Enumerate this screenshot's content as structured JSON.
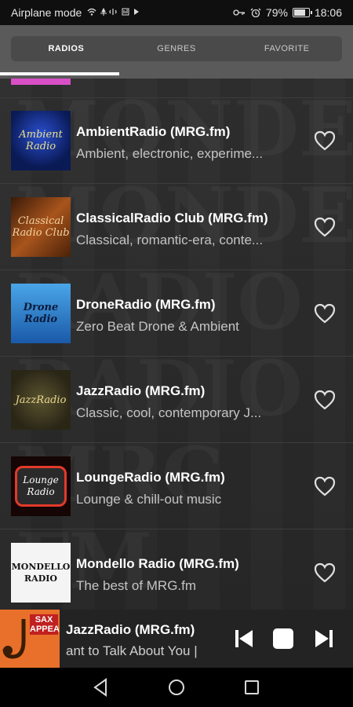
{
  "status_bar": {
    "carrier": "Airplane mode",
    "battery": "79%",
    "time": "18:06"
  },
  "tabs": [
    {
      "label": "RADIOS",
      "active": true
    },
    {
      "label": "GENRES",
      "active": false
    },
    {
      "label": "FAVORITE",
      "active": false
    }
  ],
  "stations": [
    {
      "title": "AmbientRadio (MRG.fm)",
      "subtitle": "Ambient, electronic, experime...",
      "logo_text": "Ambient Radio"
    },
    {
      "title": "ClassicalRadio Club (MRG.fm)",
      "subtitle": "Classical, romantic-era, conte...",
      "logo_text": "Classical Radio Club"
    },
    {
      "title": "DroneRadio (MRG.fm)",
      "subtitle": "Zero Beat Drone & Ambient",
      "logo_text": "Drone Radio"
    },
    {
      "title": "JazzRadio (MRG.fm)",
      "subtitle": "Classic, cool, contemporary J...",
      "logo_text": "JazzRadio"
    },
    {
      "title": "LoungeRadio (MRG.fm)",
      "subtitle": "Lounge & chill-out music",
      "logo_text": "Lounge Radio"
    },
    {
      "title": "Mondello Radio (MRG.fm)",
      "subtitle": "The best of MRG.fm",
      "logo_text": "MONDELLO RADIO"
    }
  ],
  "now_playing": {
    "title": "JazzRadio (MRG.fm)",
    "subtitle": "ant to Talk About You |",
    "thumb_text": "SAX APPEAL"
  },
  "colors": {
    "accent_pink": "#d94fc6",
    "tab_bar": "#5a5a5a",
    "background": "#2b2b2b"
  }
}
